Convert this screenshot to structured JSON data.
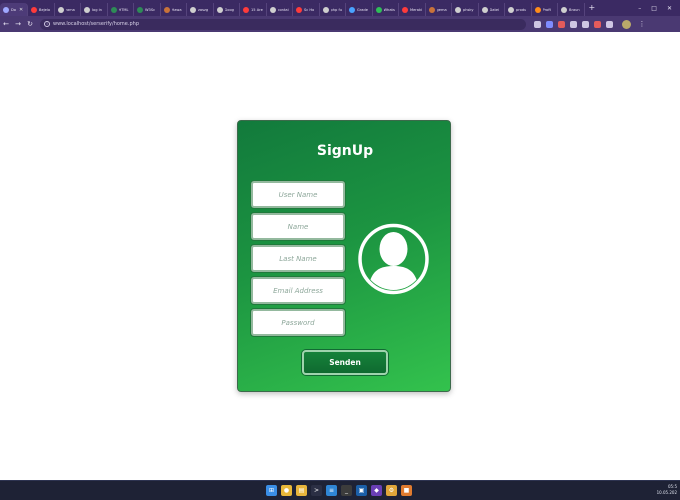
{
  "browser": {
    "tabs": [
      {
        "label": "Do",
        "color": "#9fa8ff",
        "active": true
      },
      {
        "label": "Bejelo",
        "color": "#ff3b3b"
      },
      {
        "label": "rama",
        "color": "#cfcfcf"
      },
      {
        "label": "log in",
        "color": "#cfcfcf"
      },
      {
        "label": "HTML",
        "color": "#2e8b57"
      },
      {
        "label": "W3Sc",
        "color": "#2e8b57"
      },
      {
        "label": "Hawa",
        "color": "#c9733a"
      },
      {
        "label": "zaszg",
        "color": "#cfcfcf"
      },
      {
        "label": "Goog",
        "color": "#cfcfcf"
      },
      {
        "label": "15 Are",
        "color": "#ff3b3b"
      },
      {
        "label": "contai",
        "color": "#cfcfcf"
      },
      {
        "label": "Sc Ho",
        "color": "#ff3b3b"
      },
      {
        "label": "php fu",
        "color": "#cfcfcf"
      },
      {
        "label": "Grade",
        "color": "#4aa3ff"
      },
      {
        "label": "Whats",
        "color": "#2fbf58"
      },
      {
        "label": "Meraki",
        "color": "#ff3b3b"
      },
      {
        "label": "gema",
        "color": "#c9733a"
      },
      {
        "label": "phsky",
        "color": "#cfcfcf"
      },
      {
        "label": "Datei",
        "color": "#cfcfcf"
      },
      {
        "label": "produ",
        "color": "#cfcfcf"
      },
      {
        "label": "Profil",
        "color": "#ff8c1a"
      },
      {
        "label": "Braun",
        "color": "#cfcfcf"
      }
    ],
    "new_tab": "+",
    "window_controls": [
      "–",
      "□",
      "✕"
    ],
    "nav": {
      "back": "←",
      "forward": "→",
      "reload": "↻"
    },
    "url": "www.localhost/serserify/home.php"
  },
  "form": {
    "title": "SignUp",
    "fields": [
      {
        "placeholder": "User Name"
      },
      {
        "placeholder": "Name"
      },
      {
        "placeholder": "Last Name"
      },
      {
        "placeholder": "Email Address"
      },
      {
        "placeholder": "Password"
      }
    ],
    "submit_label": "Senden"
  },
  "taskbar": {
    "apps": [
      {
        "icon": "windows-icon",
        "glyph": "⊞",
        "color": "#3a8ee6"
      },
      {
        "icon": "chrome-icon",
        "glyph": "●",
        "color": "#e8b83a"
      },
      {
        "icon": "folder-icon",
        "glyph": "▤",
        "color": "#e6b43c"
      },
      {
        "icon": "terminal-icon",
        "glyph": ">",
        "color": "#2b2f44"
      },
      {
        "icon": "vscode-icon",
        "glyph": "≡",
        "color": "#2f86d6"
      },
      {
        "icon": "console-icon",
        "glyph": "_",
        "color": "#3c3c3c"
      },
      {
        "icon": "editor-icon",
        "glyph": "▣",
        "color": "#1b5fa8"
      },
      {
        "icon": "visual-studio-icon",
        "glyph": "◆",
        "color": "#6a3fb5"
      },
      {
        "icon": "settings-icon",
        "glyph": "⚙",
        "color": "#e0a63a"
      },
      {
        "icon": "app-icon",
        "glyph": "■",
        "color": "#e07b2f"
      }
    ],
    "time": "05:5",
    "date": "10.05.202"
  }
}
